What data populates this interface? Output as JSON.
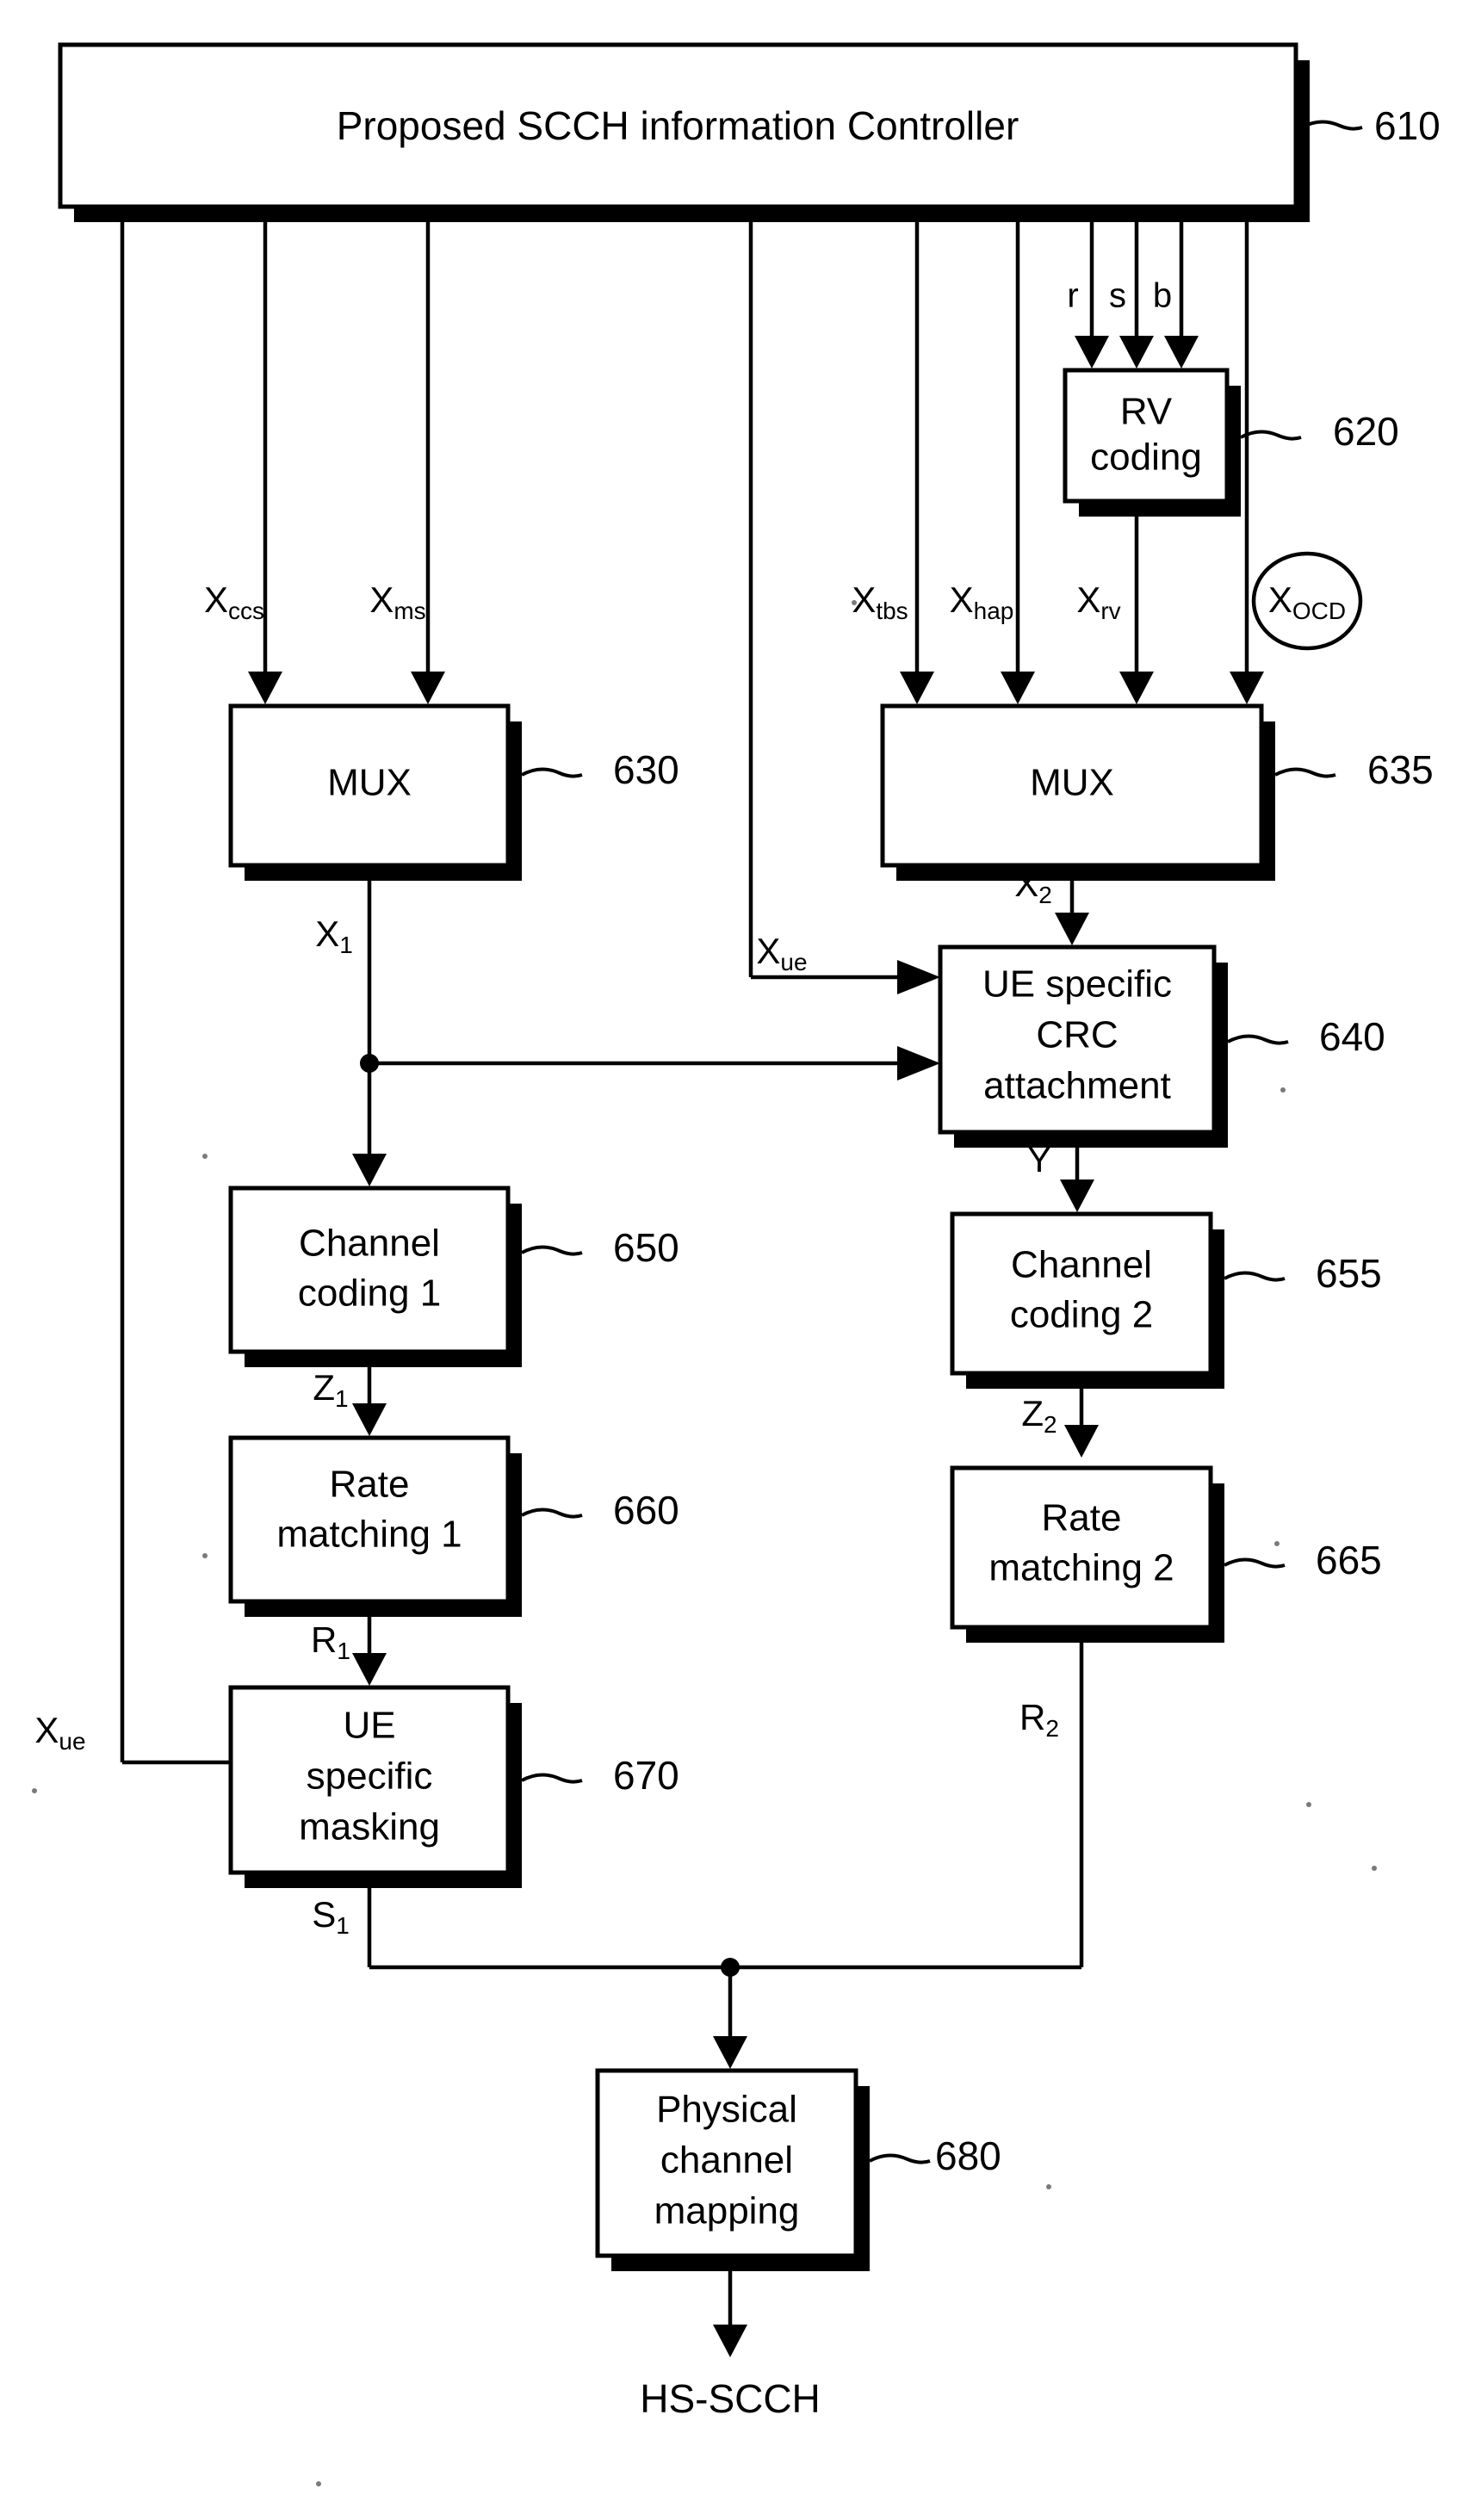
{
  "figure": {
    "type": "patent-block-diagram",
    "background_color": "#ffffff",
    "line_color": "#000000"
  },
  "blocks": {
    "controller": {
      "label": "Proposed SCCH information Controller",
      "ref": "610"
    },
    "rv_coding": {
      "label_line1": "RV",
      "label_line2": "coding",
      "ref": "620"
    },
    "mux_left": {
      "label": "MUX",
      "ref": "630"
    },
    "mux_right": {
      "label": "MUX",
      "ref": "635"
    },
    "crc": {
      "label_line1": "UE specific",
      "label_line2": "CRC",
      "label_line3": "attachment",
      "ref": "640"
    },
    "channel_coding_1": {
      "label_line1": "Channel",
      "label_line2": "coding 1",
      "ref": "650"
    },
    "channel_coding_2": {
      "label_line1": "Channel",
      "label_line2": "coding 2",
      "ref": "655"
    },
    "rate_matching_1": {
      "label_line1": "Rate",
      "label_line2": "matching 1",
      "ref": "660"
    },
    "rate_matching_2": {
      "label_line1": "Rate",
      "label_line2": "matching 2",
      "ref": "665"
    },
    "ue_masking": {
      "label_line1": "UE",
      "label_line2": "specific",
      "label_line3": "masking",
      "ref": "670"
    },
    "phys_mapping": {
      "label_line1": "Physical",
      "label_line2": "channel",
      "label_line3": "mapping",
      "ref": "680"
    }
  },
  "signals": {
    "rv_in_r": "r",
    "rv_in_s": "s",
    "rv_in_b": "b",
    "x_ccs_base": "X",
    "x_ccs_sub": "ccs",
    "x_ms_base": "X",
    "x_ms_sub": "ms",
    "x_tbs_base": "X",
    "x_tbs_sub": "tbs",
    "x_hap_base": "X",
    "x_hap_sub": "hap",
    "x_rv_base": "X",
    "x_rv_sub": "rv",
    "x_ocd_base": "X",
    "x_ocd_sub": "OCD",
    "x1_base": "X",
    "x1_sub": "1",
    "x2_base": "X",
    "x2_sub": "2",
    "xue_top_base": "X",
    "xue_top_sub": "ue",
    "xue_bottom_base": "X",
    "xue_bottom_sub": "ue",
    "y_label": "Y",
    "z1_base": "Z",
    "z1_sub": "1",
    "z2_base": "Z",
    "z2_sub": "2",
    "r1_base": "R",
    "r1_sub": "1",
    "r2_base": "R",
    "r2_sub": "2",
    "s1_base": "S",
    "s1_sub": "1",
    "output": "HS-SCCH"
  }
}
